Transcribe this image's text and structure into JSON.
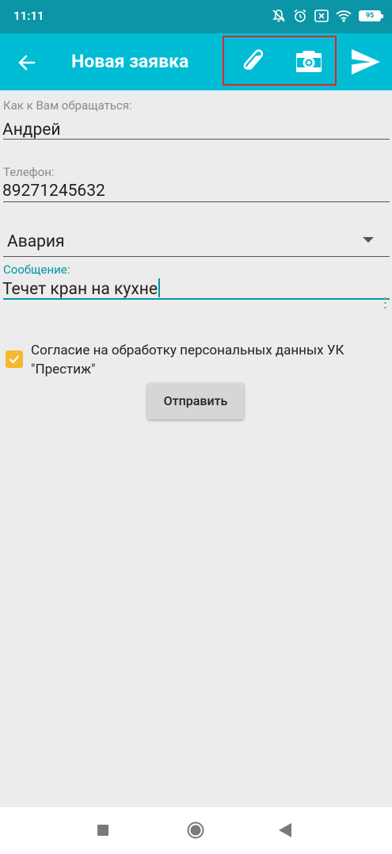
{
  "status_bar": {
    "time": "11:11",
    "battery": "95",
    "icons": [
      "bell-off-icon",
      "alarm-icon",
      "close-box-icon",
      "wifi-icon",
      "battery-icon"
    ]
  },
  "app_bar": {
    "title": "Новая заявка",
    "actions": [
      "back-arrow-icon",
      "paperclip-icon",
      "camera-icon",
      "send-icon"
    ],
    "highlight_color": "#e52421"
  },
  "form": {
    "name": {
      "label": "Как к Вам обращаться:",
      "value": "Андрей"
    },
    "phone": {
      "label": "Телефон:",
      "value": "89271245632"
    },
    "category": {
      "selected": "Авария"
    },
    "message": {
      "label": "Сообщение:",
      "value": "Течет кран на кухне"
    },
    "consent": {
      "checked": true,
      "label": "Согласие на обработку персональных данных УК \"Престиж\""
    },
    "submit_label": "Отправить"
  },
  "colors": {
    "status_bar": "#0b95a7",
    "app_bar": "#00bcd4",
    "accent": "#0097a7",
    "checkbox": "#f5b82e",
    "background": "#ececec"
  }
}
